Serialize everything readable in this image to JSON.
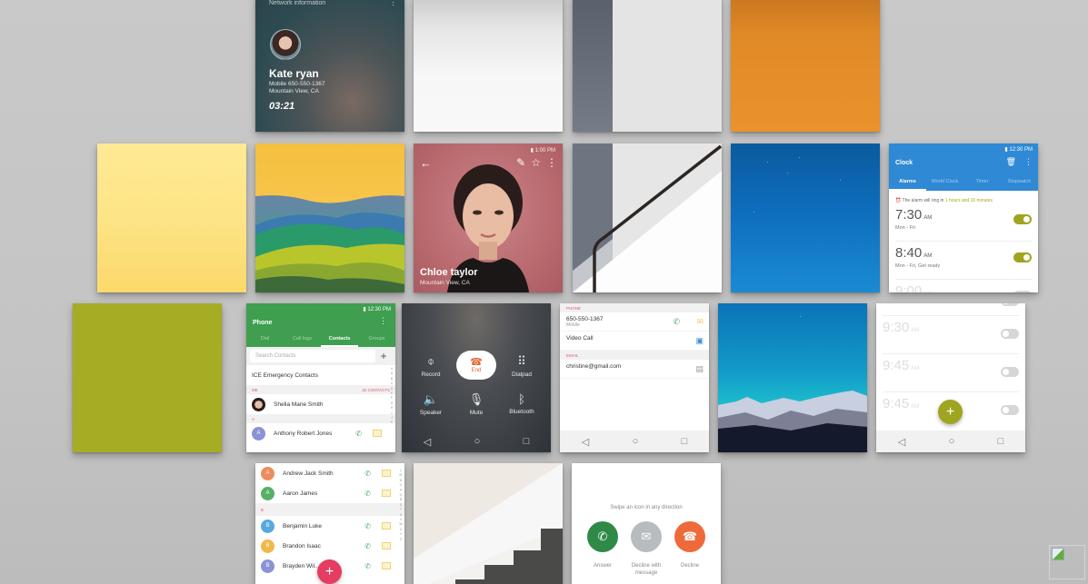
{
  "call_card": {
    "header": "Network information",
    "name": "Kate ryan",
    "phone_line": "Mobile 650-550-1367",
    "location": "Mountain View, CA",
    "duration": "03:21"
  },
  "contact_profile": {
    "status_time": "1:00 PM",
    "name": "Chloe taylor",
    "location": "Mountain View, CA"
  },
  "clock": {
    "status_time": "12:30 PM",
    "title": "Clock",
    "tabs": [
      "Alarms",
      "World Clock",
      "Timer",
      "Stopwatch"
    ],
    "active_tab": "Alarms",
    "note_prefix": "The alarm will ring in",
    "note_highlight": "1 hours and 10 minutes",
    "alarms": [
      {
        "time": "7:30",
        "ampm": "AM",
        "days": "Mon - Fri",
        "enabled": true
      },
      {
        "time": "8:40",
        "ampm": "AM",
        "days": "Mon - Fri, Get ready",
        "enabled": true
      },
      {
        "time": "9:00",
        "ampm": "AM",
        "days": "",
        "enabled": false
      }
    ],
    "accent": "#2f89d4",
    "toggle_on_color": "#9fa51f"
  },
  "alarms_more": {
    "alarms": [
      {
        "time": "9:30",
        "ampm": "AM",
        "enabled": false
      },
      {
        "time": "9:45",
        "ampm": "AM",
        "enabled": false
      },
      {
        "time": "9:45",
        "ampm": "AM",
        "enabled": false
      }
    ],
    "fab_label": "+"
  },
  "phone": {
    "status_time": "12:30 PM",
    "title": "Phone",
    "tabs": [
      "Dial",
      "Call logs",
      "Contacts",
      "Groups"
    ],
    "active_tab": "Contacts",
    "search_placeholder": "Search Contacts",
    "ice_label": "ICE Emergency Contacts",
    "me_section": "ME",
    "contacts_count": "32 CONTACTS",
    "me_name": "Shelia Marie Smith",
    "section_a": "A",
    "contacts_a": [
      {
        "initial": "A",
        "name": "Anthony Robert Jones",
        "color": "#8b93d6"
      }
    ],
    "accent": "#3f9e4f",
    "alphabet": [
      "#",
      "A",
      "B",
      "C",
      "D",
      "E",
      "F",
      "G",
      "H",
      "I",
      "J",
      "K"
    ]
  },
  "contacts_list": {
    "items": [
      {
        "initial": "A",
        "name": "Andrew Jack Smith",
        "color": "#ef8b5a"
      },
      {
        "initial": "A",
        "name": "Aaron James",
        "color": "#55b164"
      }
    ],
    "section_b": "B",
    "items_b": [
      {
        "initial": "B",
        "name": "Benjamin Luke",
        "color": "#58a9e0"
      },
      {
        "initial": "B",
        "name": "Brandon Isaac",
        "color": "#f0b84a"
      },
      {
        "initial": "B",
        "name": "Brayden Wil...",
        "color": "#8b93d6"
      }
    ],
    "alphabet": [
      "L",
      "M",
      "N",
      "O",
      "P",
      "Q",
      "R",
      "S",
      "T",
      "U",
      "V",
      "W",
      "X",
      "Y",
      "Z"
    ],
    "fab_color": "#e53c61"
  },
  "in_call": {
    "buttons": [
      {
        "icon": "voicemail-icon",
        "label": "Record"
      },
      {
        "icon": "end-call-icon",
        "label": "End"
      },
      {
        "icon": "dialpad-icon",
        "label": "Dialpad"
      },
      {
        "icon": "speaker-icon",
        "label": "Speaker"
      },
      {
        "icon": "mute-icon",
        "label": "Mute"
      },
      {
        "icon": "bluetooth-icon",
        "label": "Bluetooth"
      }
    ],
    "end_color": "#e2632f"
  },
  "contact_detail": {
    "phone_section": "PHONE",
    "phone_number": "650-550-1367",
    "phone_type": "Mobile",
    "video_call": "Video Call",
    "email_section": "EMAIL",
    "email": "christine@gmail.com"
  },
  "incoming": {
    "hint": "Swipe an icon in any direction",
    "answer_label": "Answer",
    "decline_msg_label": "Decline with message",
    "decline_label": "Decline",
    "answer_color": "#2f8a48",
    "decline_msg_color": "#b9bcbe",
    "decline_color": "#ee6a3a"
  },
  "swatches": {
    "orange": "#ea922c",
    "yellow": "#fde486",
    "olive": "#a6ad24"
  },
  "navbar": {
    "back": "◁",
    "home": "○",
    "recents": "□"
  }
}
